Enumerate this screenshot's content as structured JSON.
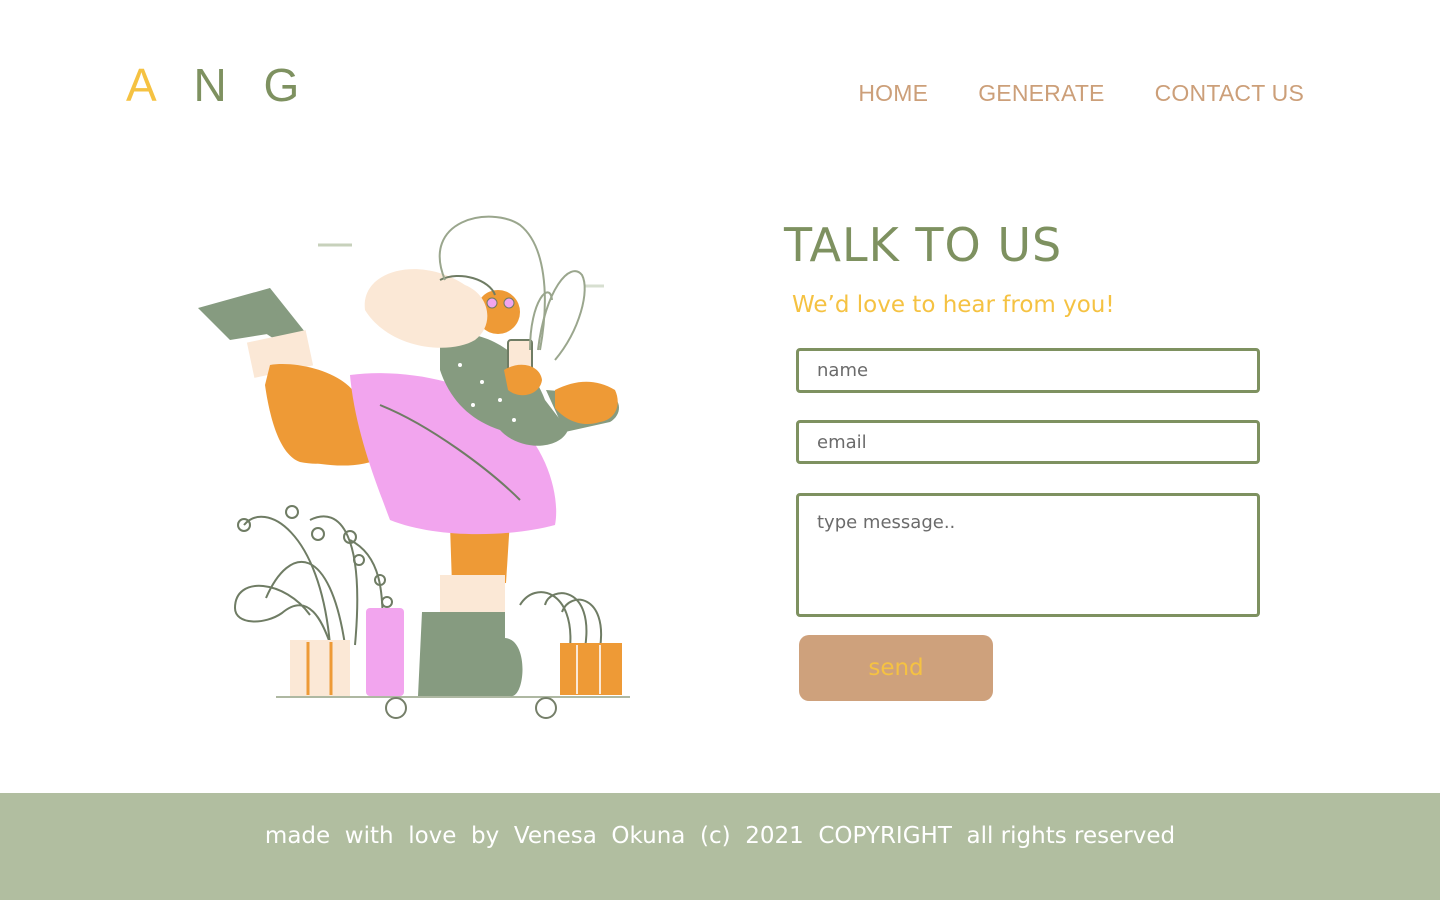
{
  "logo": {
    "letters": [
      "A",
      "N",
      "G"
    ]
  },
  "nav": {
    "items": [
      "HOME",
      "GENERATE",
      "CONTACT US"
    ]
  },
  "contact": {
    "title": "TALK TO US",
    "subtitle": "We’d love to hear from you!",
    "name_placeholder": "name",
    "email_placeholder": "email",
    "message_placeholder": "type message..",
    "send_label": "send"
  },
  "footer": {
    "text": "made  with  love  by  Venesa  Okuna  (c)  2021  COPYRIGHT  all rights reserved"
  },
  "colors": {
    "green": "#7e9160",
    "yellow": "#f5c242",
    "tan": "#cea17c",
    "footer_bg": "#b1bea0"
  },
  "illustration": {
    "icon": "woman-running-with-plants-illustration"
  }
}
